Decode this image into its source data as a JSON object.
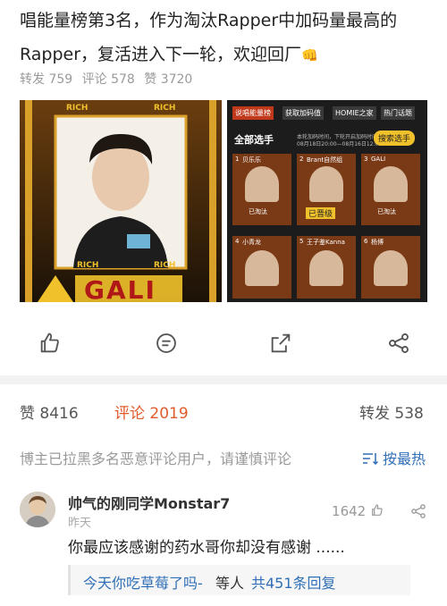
{
  "post": {
    "line1": "唱能量榜第3名，作为淘汰Rapper中加码量最高的",
    "line2": "Rapper，复活进入下一轮，欢迎回厂",
    "emoji": "👊"
  },
  "post_stats": {
    "repost": "转发 759",
    "comment": "评论 578",
    "like": "赞 3720"
  },
  "images": {
    "left": {
      "banner_top_l": "RICH",
      "banner_top_r": "RICH",
      "banner_bottom_l": "RICH",
      "banner_bottom_r": "RICH",
      "side_text": "GALI",
      "big_text": "GALI"
    },
    "right": {
      "tabs": [
        "说唱能量榜",
        "获取加码值",
        "HOMIE之家",
        "热门话题"
      ],
      "section_title": "全部选手",
      "search_label": "搜索选手",
      "date_line1": "本轮加码时间，下轮开启加码时间",
      "date_line2": "08月18日20:00—08月16日12:00",
      "players": [
        {
          "rank": "1",
          "name": "贝乐乐",
          "tag": "已淘汰"
        },
        {
          "rank": "2",
          "name": "Brant自然组",
          "tag": "已晋级"
        },
        {
          "rank": "3",
          "name": "GALI",
          "tag": "已淘汰"
        },
        {
          "rank": "4",
          "name": "小青龙",
          "tag": ""
        },
        {
          "rank": "5",
          "name": "王子鉴Kanna",
          "tag": ""
        },
        {
          "rank": "6",
          "name": "杨博",
          "tag": ""
        }
      ],
      "tag_promoted": "已晋级"
    }
  },
  "actions": [
    "like-icon",
    "comment-icon",
    "repost-icon",
    "share-icon"
  ],
  "tabs": {
    "like": "赞 8416",
    "comment": "评论 2019",
    "repost": "转发 538"
  },
  "notice": "博主已拉黑多名恶意评论用户，请谨慎评论",
  "sort_label": "按最热",
  "comment": {
    "username": "帅气的刚同学Monstar7",
    "time": "昨天",
    "likes": "1642",
    "text": "你最应该感谢的药水哥你却没有感谢 ......",
    "reply_preview": "今天你吃草莓了吗-",
    "reply_user": "等人",
    "reply_count": "共451条回复"
  },
  "colors": {
    "accent_orange": "#e05a2b",
    "link_blue": "#2f6fb7",
    "gold": "#d9a02a"
  }
}
